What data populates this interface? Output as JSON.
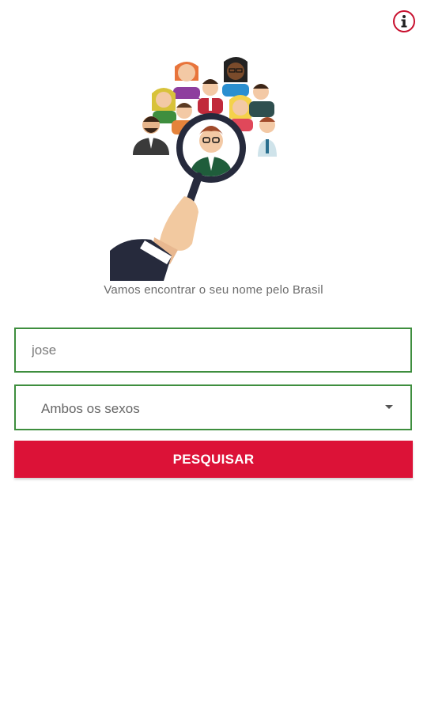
{
  "header": {
    "info_icon": "info-circle-icon"
  },
  "hero": {
    "illustration": "magnifying-glass-over-people-illustration"
  },
  "tagline": "Vamos encontrar o seu nome pelo Brasil",
  "form": {
    "name_value": "jose",
    "sex_select_value": "Ambos os sexos",
    "search_label": "PESQUISAR"
  },
  "colors": {
    "accent_red": "#dc1237",
    "field_border_green": "#3e8e3e"
  }
}
